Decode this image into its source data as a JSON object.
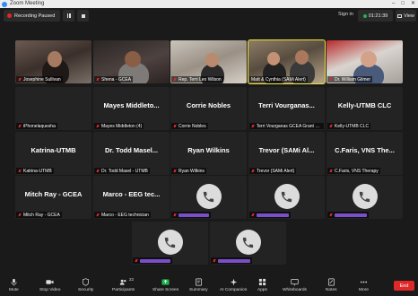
{
  "window": {
    "title": "Zoom Meeting"
  },
  "topbar": {
    "recording_label": "Recording Paused",
    "signin_label": "Sign in",
    "timer": "01:21:39",
    "view_label": "View"
  },
  "tiles": [
    {
      "name": "Josephine Sullivan",
      "big": "",
      "type": "video"
    },
    {
      "name": "Shena - GCEA",
      "big": "",
      "type": "video"
    },
    {
      "name": "Rep. Terri Leo Wilson",
      "big": "",
      "type": "video"
    },
    {
      "name": "Matt & Cynthia (SAMi Alert)",
      "big": "",
      "type": "video"
    },
    {
      "name": "Dr. William Gilmer",
      "big": "",
      "type": "video"
    },
    {
      "name": "iPhonelaquesha",
      "big": "",
      "type": "blank"
    },
    {
      "name": "Mayes Middleton (4)",
      "big": "Mayes Middleto...",
      "type": "text"
    },
    {
      "name": "Corrie Nobles",
      "big": "Corrie Nobles",
      "type": "text"
    },
    {
      "name": "Terri Vourganas GCEA Grant Writer",
      "big": "Terri Vourganas...",
      "type": "text"
    },
    {
      "name": "Kelly-UTMB CLC",
      "big": "Kelly-UTMB CLC",
      "type": "text"
    },
    {
      "name": "Katrina-UTMB",
      "big": "Katrina-UTMB",
      "type": "text"
    },
    {
      "name": "Dr. Todd Masel - UTMB",
      "big": "Dr. Todd Masel...",
      "type": "text"
    },
    {
      "name": "Ryan Wilkins",
      "big": "Ryan Wilkins",
      "type": "text"
    },
    {
      "name": "Trevor (SAMi Alert)",
      "big": "Trevor (SAMi Al...",
      "type": "text"
    },
    {
      "name": "C.Faris, VNS Therapy",
      "big": "C.Faris, VNS The...",
      "type": "text"
    },
    {
      "name": "Mitch Ray - GCEA",
      "big": "Mitch Ray - GCEA",
      "type": "text"
    },
    {
      "name": "Marco - EEG technician",
      "big": "Marco - EEG tec...",
      "type": "text"
    },
    {
      "name": "",
      "big": "",
      "type": "phone"
    },
    {
      "name": "",
      "big": "",
      "type": "phone"
    },
    {
      "name": "",
      "big": "",
      "type": "phone"
    },
    {
      "name": "",
      "big": "",
      "type": "phone"
    },
    {
      "name": "",
      "big": "",
      "type": "phone"
    }
  ],
  "toolbar": {
    "mute": "Mute",
    "stop_video": "Stop Video",
    "security": "Security",
    "participants": "Participants",
    "participants_count": "22",
    "share_screen": "Share Screen",
    "summary": "Summary",
    "ai_companion": "AI Companion",
    "apps": "Apps",
    "whiteboards": "Whiteboards",
    "notes": "Notes",
    "more": "More",
    "end": "End"
  },
  "colors": {
    "end": "#e02828",
    "share": "#21b34f",
    "active_speaker": "#f0e33b"
  }
}
